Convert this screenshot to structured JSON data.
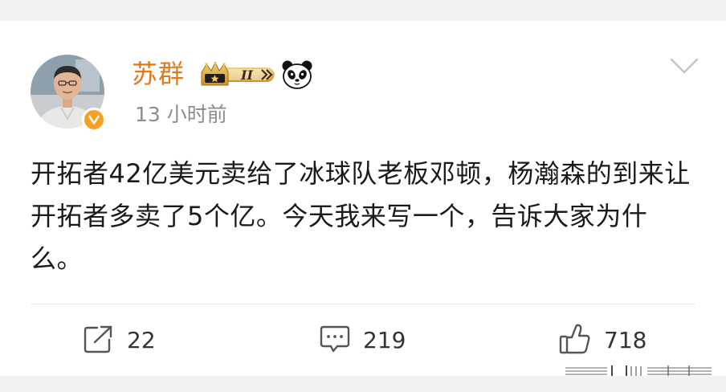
{
  "post": {
    "author": {
      "name": "苏群",
      "vip_level": "II"
    },
    "timestamp": "13 小时前",
    "text": "开拓者42亿美元卖给了冰球队老板邓顿，杨瀚森的到来让开拓者多卖了5个亿。今天我来写一个，告诉大家为什么。",
    "actions": {
      "reposts": "22",
      "comments": "219",
      "likes": "718"
    }
  },
  "icons": {
    "menu": "chevron-down-icon",
    "repost": "repost-icon",
    "comment": "comment-icon",
    "like": "thumbs-up-icon",
    "verified": "verified-badge-icon",
    "emoji": "panda-icon"
  },
  "colors": {
    "username": "#e27a1d",
    "timestamp": "#8c8c8c",
    "text": "#1a1a1a",
    "verified": "#f7a123",
    "vip_gold": "#d8a53a"
  }
}
